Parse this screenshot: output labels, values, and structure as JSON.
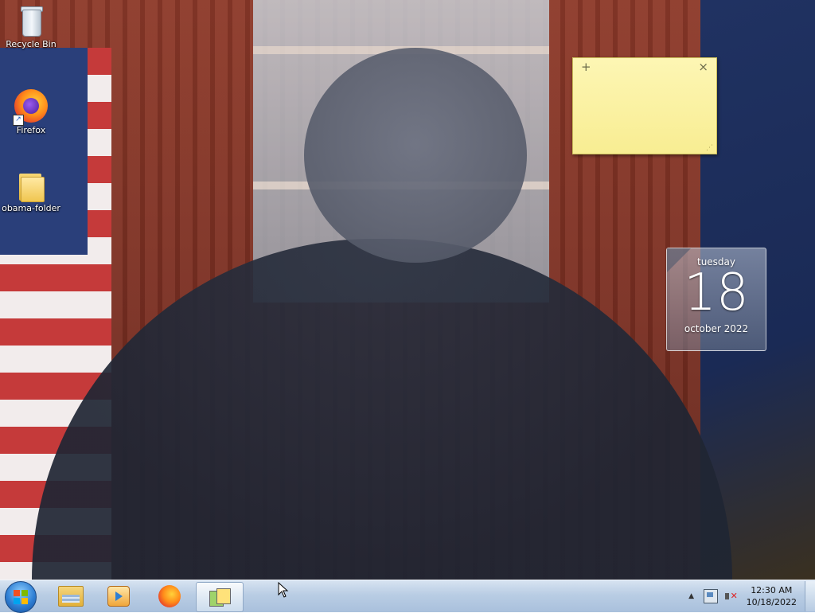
{
  "desktop": {
    "icons": [
      {
        "label": "Recycle Bin",
        "icon": "recycle-bin-icon"
      },
      {
        "label": "Firefox",
        "icon": "firefox-icon"
      },
      {
        "label": "obama-folder",
        "icon": "folder-icon"
      }
    ]
  },
  "sticky_note": {
    "add_symbol": "+",
    "close_symbol": "×",
    "text": ""
  },
  "calendar": {
    "weekday": "tuesday",
    "day": "18",
    "month_year": "october 2022"
  },
  "taskbar": {
    "pinned": [
      {
        "name": "windows-explorer",
        "icon": "folder-icon"
      },
      {
        "name": "windows-media-player",
        "icon": "media-player-icon"
      },
      {
        "name": "firefox",
        "icon": "firefox-icon"
      },
      {
        "name": "desktop-gadgets",
        "icon": "gadgets-icon",
        "active": true
      }
    ],
    "tray": {
      "show_hidden_symbol": "▲",
      "time": "12:30 AM",
      "date": "10/18/2022"
    }
  }
}
